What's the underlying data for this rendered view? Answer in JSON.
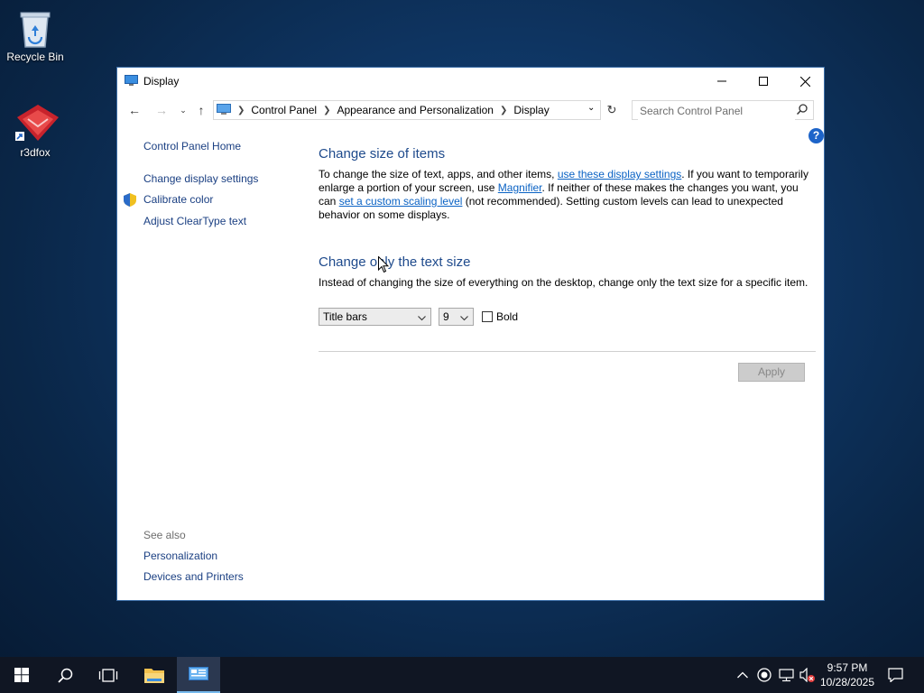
{
  "desktop": {
    "icons": [
      {
        "label": "Recycle Bin",
        "icon": "recycle-bin-icon"
      },
      {
        "label": "r3dfox",
        "icon": "r3dfox-app-icon"
      }
    ]
  },
  "window": {
    "title": "Display",
    "controls": {
      "minimize": "minimize-icon",
      "maximize": "maximize-icon",
      "close": "close-icon"
    },
    "breadcrumb": [
      "Control Panel",
      "Appearance and Personalization",
      "Display"
    ],
    "search": {
      "placeholder": "Search Control Panel",
      "value": ""
    },
    "help_label": "?"
  },
  "left_pane": {
    "home": "Control Panel Home",
    "links": [
      "Change display settings",
      "Calibrate color",
      "Adjust ClearType text"
    ],
    "see_also_label": "See also",
    "see_also": [
      "Personalization",
      "Devices and Printers"
    ]
  },
  "section1": {
    "heading": "Change size of items",
    "p1": "To change the size of text, apps, and other items, ",
    "link1": "use these display settings",
    "p2": ".  If you want to temporarily enlarge a portion of your screen, use ",
    "link2": "Magnifier",
    "p3": ".  If neither of these makes the changes you want, you can ",
    "link3": "set a custom scaling level",
    "p4": " (not recommended).  Setting custom levels can lead to unexpected behavior on some displays."
  },
  "section2": {
    "heading": "Change only the text size",
    "description": "Instead of changing the size of everything on the desktop, change only the text size for a specific item.",
    "item_select": "Title bars",
    "size_select": "9",
    "bold_label": "Bold",
    "bold_checked": false,
    "apply_label": "Apply"
  },
  "taskbar": {
    "items": [
      "start-icon",
      "search-icon",
      "task-view-icon",
      "file-explorer-icon",
      "control-panel-icon"
    ],
    "tray": [
      "chevron-up-icon",
      "record-icon",
      "network-icon",
      "volume-muted-icon"
    ],
    "time": "9:57 PM",
    "date": "10/28/2025"
  },
  "colors": {
    "link": "#0a62c4",
    "heading": "#1e4a8c",
    "nav_link": "#1a3f82",
    "taskbar": "#101623",
    "accent": "#76b9ed"
  }
}
